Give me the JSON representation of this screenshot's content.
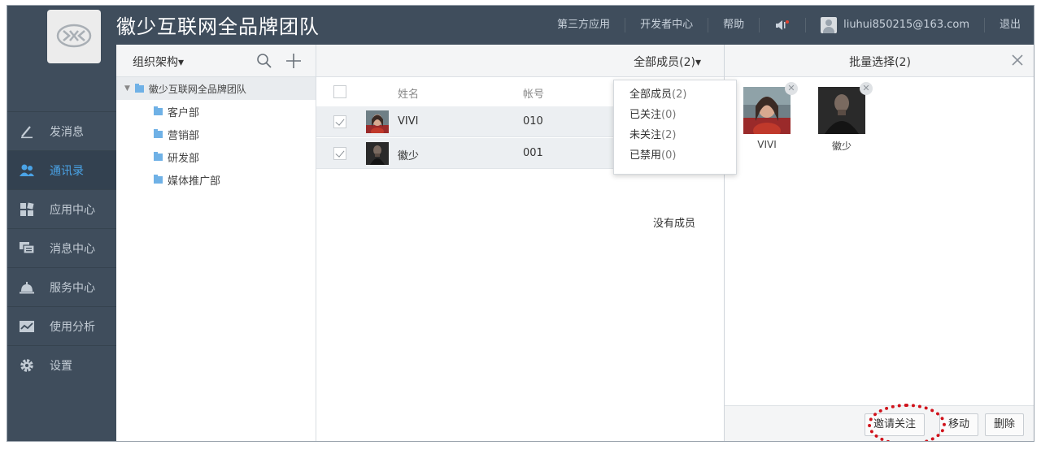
{
  "app": {
    "team_name": "徽少互联网全品牌团队"
  },
  "topnav": {
    "items": [
      {
        "label": "第三方应用"
      },
      {
        "label": "开发者中心"
      },
      {
        "label": "帮助"
      }
    ],
    "user_email": "liuhui850215@163.com",
    "logout_label": "退出",
    "speaker_icon": "speaker-icon"
  },
  "sidebar": {
    "logo_icon": "chat-logo-icon",
    "items": [
      {
        "label": "发消息",
        "icon": "pen-icon",
        "active": false
      },
      {
        "label": "通讯录",
        "icon": "contacts-icon",
        "active": true
      },
      {
        "label": "应用中心",
        "icon": "apps-icon",
        "active": false
      },
      {
        "label": "消息中心",
        "icon": "messages-icon",
        "active": false
      },
      {
        "label": "服务中心",
        "icon": "service-bell-icon",
        "active": false
      },
      {
        "label": "使用分析",
        "icon": "chart-icon",
        "active": false
      },
      {
        "label": "设置",
        "icon": "gear-icon",
        "active": false
      }
    ],
    "accent_color": "#4aa3e6"
  },
  "org_tree": {
    "header_label": "组织架构▾",
    "root": "徽少互联网全品牌团队",
    "departments": [
      "客户部",
      "营销部",
      "研发部",
      "媒体推广部"
    ]
  },
  "members": {
    "filter_label": "全部成员(2)▾",
    "columns": {
      "name": "姓名",
      "account": "帐号"
    },
    "rows": [
      {
        "name": "VIVI",
        "account": "010",
        "checked": true
      },
      {
        "name": "徽少",
        "account": "001",
        "checked": true
      }
    ],
    "empty_note": "没有成员",
    "dropdown": [
      {
        "label": "全部成员",
        "count": "(2)"
      },
      {
        "label": "已关注",
        "count": "(0)"
      },
      {
        "label": "未关注",
        "count": "(2)"
      },
      {
        "label": "已禁用",
        "count": "(0)"
      }
    ]
  },
  "batch": {
    "title": "批量选择(2)",
    "selected": [
      {
        "name": "VIVI"
      },
      {
        "name": "徽少"
      }
    ],
    "buttons": {
      "invite": "邀请关注",
      "move": "移动",
      "delete": "删除"
    },
    "highlight_color": "#d0121b"
  }
}
